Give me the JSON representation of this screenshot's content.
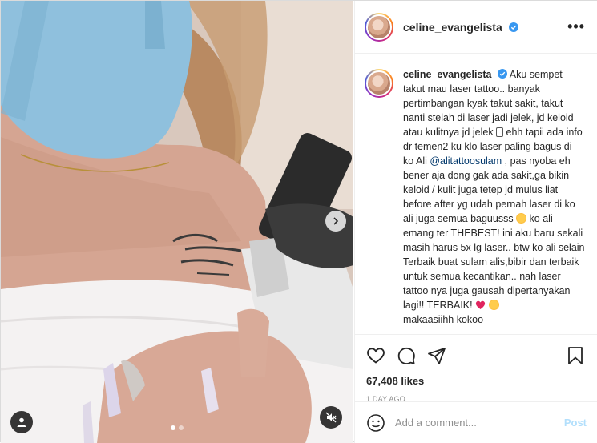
{
  "post": {
    "username": "celine_evangelista",
    "verified": true,
    "caption_user": "celine_evangelista",
    "caption_part1": "Aku sempet takut mau laser tattoo.. banyak pertimbangan kyak takut sakit, takut nanti stelah di laser jadi jelek, jd keloid atau kulitnya jd jelek ",
    "caption_part2": " ehh tapii ada info dr temen2 ku klo laser paling bagus di ko Ali ",
    "mention": "@alitattoosulam",
    "caption_part3": " , pas nyoba eh bener aja dong gak ada sakit,ga bikin keloid / kulit juga tetep jd mulus liat before after yg udah pernah laser di ko ali juga semua baguusss ",
    "caption_part4": " ko ali emang ter THEBEST! ini aku baru sekali masih harus 5x lg laser.. btw ko ali selain Terbaik buat sulam alis,bibir dan terbaik untuk semua kecantikan.. nah laser tattoo nya juga gausah dipertanyakan lagi!! TERBAIK! ",
    "caption_part5": "makaasiihh kokoo",
    "likes": "67,408 likes",
    "timestamp": "1 DAY AGO"
  },
  "icons": {
    "more": "more-options-icon",
    "like": "heart-icon",
    "comment": "comment-icon",
    "share": "share-icon",
    "save": "bookmark-icon",
    "emoji": "smiley-icon",
    "next": "chevron-right-icon",
    "tag": "user-tag-icon",
    "mute": "muted-speaker-icon"
  },
  "comment_box": {
    "placeholder": "Add a comment...",
    "post_label": "Post"
  },
  "colors": {
    "verified": "#3897f0",
    "heart": "#ed4956",
    "link": "#00376b",
    "post_disabled": "#b2dffc"
  },
  "media": {
    "slide_count": 2,
    "active_slide": 1
  }
}
